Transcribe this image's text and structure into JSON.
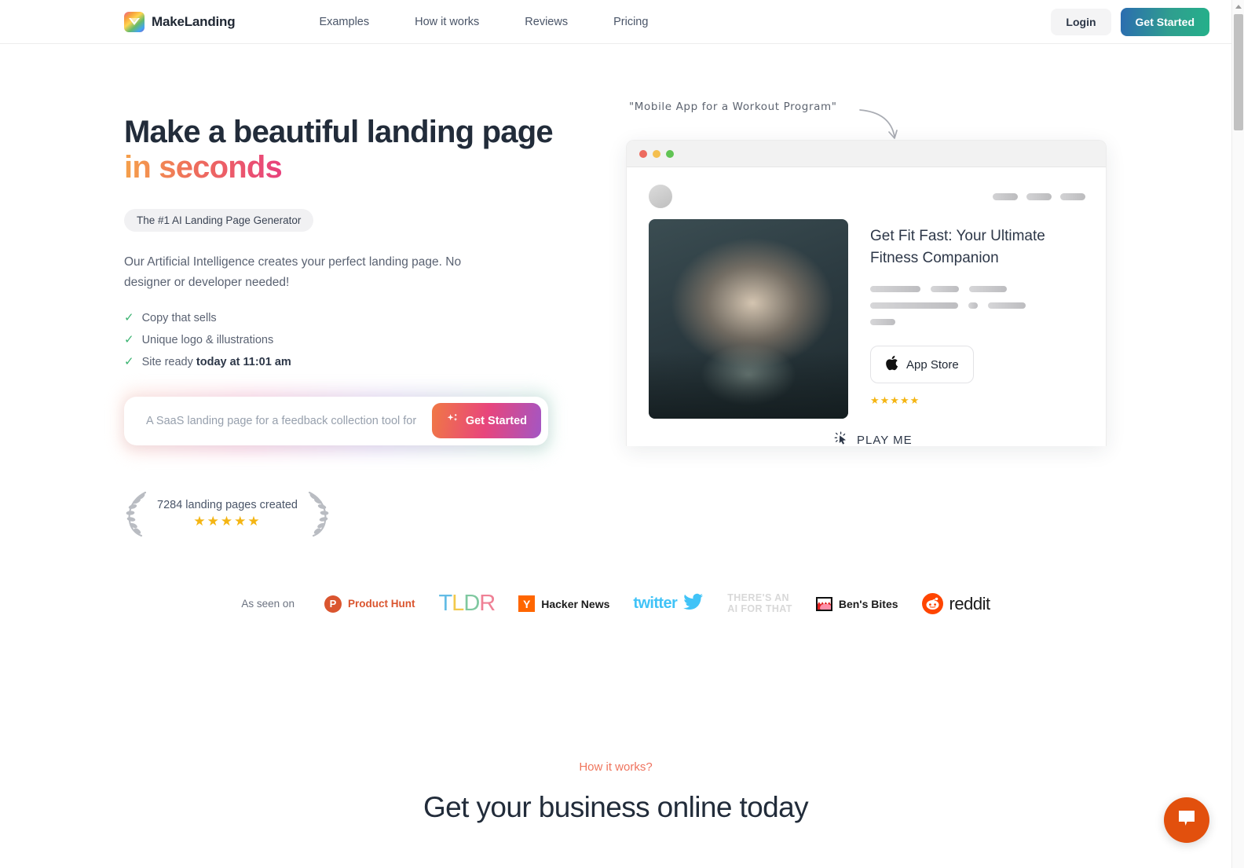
{
  "brand": {
    "name": "MakeLanding",
    "logo_icon": "chevron-logo-icon"
  },
  "nav": {
    "items": [
      {
        "label": "Examples"
      },
      {
        "label": "How it works"
      },
      {
        "label": "Reviews"
      },
      {
        "label": "Pricing"
      }
    ],
    "login_label": "Login",
    "get_started_label": "Get Started"
  },
  "hero": {
    "headline_line1": "Make a beautiful landing page",
    "headline_line2": "in seconds",
    "badge": "The #1 AI Landing Page Generator",
    "lead": "Our Artificial Intelligence creates your perfect landing page. No designer or developer needed!",
    "checklist": [
      {
        "text": "Copy that sells",
        "bold": ""
      },
      {
        "text": "Unique logo & illustrations",
        "bold": ""
      },
      {
        "text": "Site ready ",
        "bold": "today at 11:01 am"
      }
    ],
    "prompt_placeholder": "A SaaS landing page for a feedback collection tool for",
    "prompt_value": "",
    "cta_label": "Get Started",
    "cta_icon": "sparkle-icon",
    "social_proof_count": "7284 landing pages created",
    "social_proof_stars": "★★★★★"
  },
  "preview": {
    "annotation": "\"Mobile App for a Workout Program\"",
    "window_dots": [
      "#ed6a5e",
      "#f4bf4f",
      "#61c454"
    ],
    "title": "Get Fit Fast: Your Ultimate Fitness Companion",
    "image_alt": "woman-flexing-gym-photo",
    "appstore_label": "App Store",
    "appstore_icon": "apple-icon",
    "stars": "★★★★★",
    "skeleton_rows": [
      [
        64,
        36,
        48
      ],
      [
        112,
        12,
        48
      ],
      [
        32
      ]
    ],
    "play_label": "PLAY ME",
    "play_icon": "click-cursor-icon"
  },
  "seen_on": {
    "label": "As seen on",
    "logos": [
      {
        "name": "Product Hunt",
        "mark": "P"
      },
      {
        "name": "TLDR",
        "letters": [
          "T",
          "L",
          "D",
          "R"
        ]
      },
      {
        "name": "Hacker News",
        "mark": "Y"
      },
      {
        "name": "twitter"
      },
      {
        "name": "THERE'S AN AI FOR THAT",
        "line1": "THERE'S AN",
        "line2": "AI FOR THAT"
      },
      {
        "name": "Ben's Bites"
      },
      {
        "name": "reddit"
      }
    ]
  },
  "how_it_works": {
    "kicker": "How it works?",
    "title": "Get your business online today"
  },
  "chat": {
    "icon": "chat-bubble-icon",
    "color": "#e2500d"
  },
  "colors": {
    "accent_gradient_start": "#f5a04a",
    "accent_gradient_end": "#e8417d",
    "teal_button_start": "#2b6cb0",
    "teal_button_end": "#25b08a",
    "check_green": "#3bb371",
    "star_gold": "#f4b513"
  }
}
